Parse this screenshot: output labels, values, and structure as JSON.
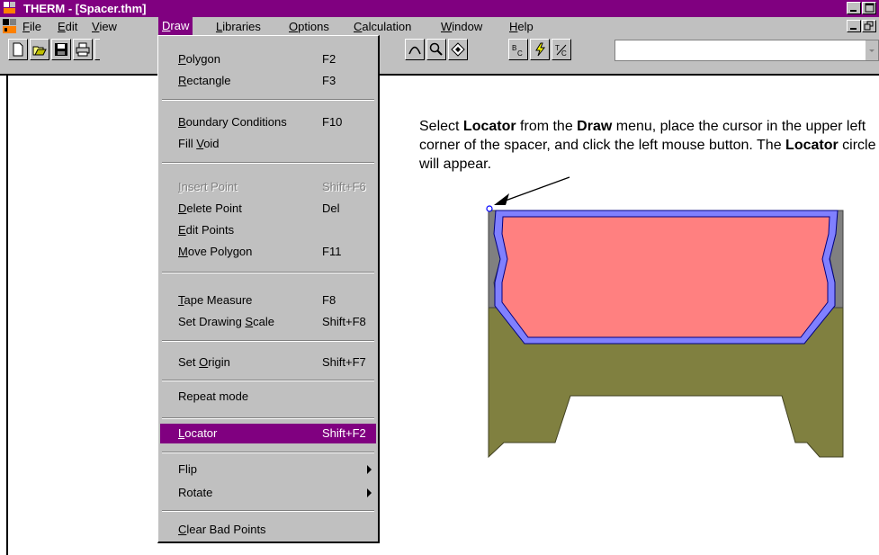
{
  "window": {
    "title": "THERM - [Spacer.thm]"
  },
  "menubar": {
    "items": [
      {
        "label": "File",
        "ul": "F",
        "rest": "ile"
      },
      {
        "label": "Edit",
        "ul": "E",
        "rest": "dit"
      },
      {
        "label": "View",
        "ul": "V",
        "rest": "iew"
      },
      {
        "label": "Draw",
        "ul": "D",
        "rest": "raw"
      },
      {
        "label": "Libraries",
        "ul": "L",
        "rest": "ibraries"
      },
      {
        "label": "Options",
        "ul": "O",
        "rest": "ptions"
      },
      {
        "label": "Calculation",
        "ul": "C",
        "rest": "alculation"
      },
      {
        "label": "Window",
        "ul": "W",
        "rest": "indow"
      },
      {
        "label": "Help",
        "ul": "H",
        "rest": "elp"
      }
    ]
  },
  "toolbar": {
    "buttons": [
      "new-icon",
      "open-icon",
      "save-icon",
      "print-icon",
      "arc-icon",
      "zoom-icon",
      "rotate-icon",
      "boundary-conditions-icon",
      "calculate-icon",
      "temperature-factor-icon"
    ],
    "bc_label": "BC",
    "combo_value": ""
  },
  "draw_menu": {
    "polygon": {
      "ul": "P",
      "rest": "olygon",
      "key": "F2"
    },
    "rectangle": {
      "ul": "R",
      "rest": "ectangle",
      "key": "F3"
    },
    "boundary_conditions": {
      "ul": "B",
      "rest": "oundary Conditions",
      "key": "F10"
    },
    "fill_void": {
      "pre": "Fill ",
      "ul": "V",
      "rest": "oid",
      "key": ""
    },
    "insert_point": {
      "ul": "I",
      "rest": "nsert Point",
      "key": "Shift+F6"
    },
    "delete_point": {
      "ul": "D",
      "rest": "elete Point",
      "key": "Del"
    },
    "edit_points": {
      "ul": "E",
      "rest": "dit Points",
      "key": ""
    },
    "move_polygon": {
      "ul": "M",
      "rest": "ove Polygon",
      "key": "F11"
    },
    "tape_measure": {
      "ul": "T",
      "rest": "ape Measure",
      "key": "F8"
    },
    "set_drawing_scale": {
      "pre": "Set Drawing ",
      "ul": "S",
      "rest": "cale",
      "key": "Shift+F8"
    },
    "set_origin": {
      "pre": "Set ",
      "ul": "O",
      "rest": "rigin",
      "key": "Shift+F7"
    },
    "repeat_mode": {
      "label": "Repeat mode",
      "key": ""
    },
    "locator": {
      "ul": "L",
      "rest": "ocator",
      "key": "Shift+F2"
    },
    "flip": {
      "label": "Flip"
    },
    "rotate": {
      "label": "Rotate"
    },
    "clear_bad_points": {
      "ul": "C",
      "rest": "lear Bad Points",
      "key": ""
    }
  },
  "caption": {
    "t1": "Select ",
    "b1": "Locator",
    "t2": " from the ",
    "b2": "Draw",
    "t3": " menu, place the cursor in the upper left corner of the spacer, and click the left mouse button. The ",
    "b3": "Locator",
    "t4": " circle will appear."
  },
  "colors": {
    "title_bar": "#800080",
    "menu_highlight": "#800080",
    "spacer_fill": "#ff8080",
    "spacer_border": "#8080ff",
    "sealant": "#808040",
    "side_gray": "#808080"
  }
}
